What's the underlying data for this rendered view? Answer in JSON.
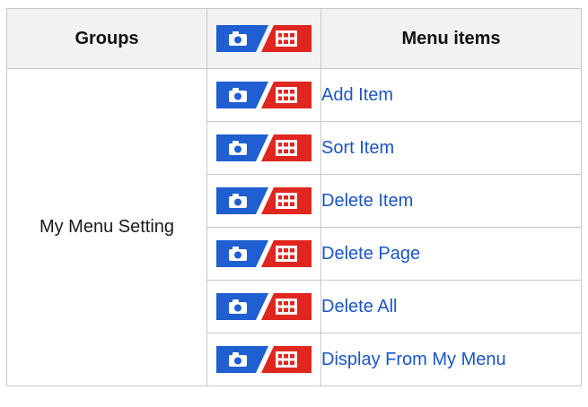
{
  "table": {
    "header_groups": "Groups",
    "header_menu_items": "Menu items",
    "header_mode_icon": "photo-movie-mode-icon",
    "group_label": "My Menu Setting",
    "rows": [
      {
        "item": "Add Item",
        "mode_icon": "photo-movie-mode-icon"
      },
      {
        "item": "Sort Item",
        "mode_icon": "photo-movie-mode-icon"
      },
      {
        "item": "Delete Item",
        "mode_icon": "photo-movie-mode-icon"
      },
      {
        "item": "Delete Page",
        "mode_icon": "photo-movie-mode-icon"
      },
      {
        "item": "Delete All",
        "mode_icon": "photo-movie-mode-icon"
      },
      {
        "item": "Display From My Menu",
        "mode_icon": "photo-movie-mode-icon"
      }
    ]
  },
  "colors": {
    "photo_blue": "#1f5fd1",
    "movie_red": "#e0261f",
    "link_blue": "#1a56c8",
    "header_bg": "#f2f2f2",
    "border": "#c8c8c8"
  }
}
